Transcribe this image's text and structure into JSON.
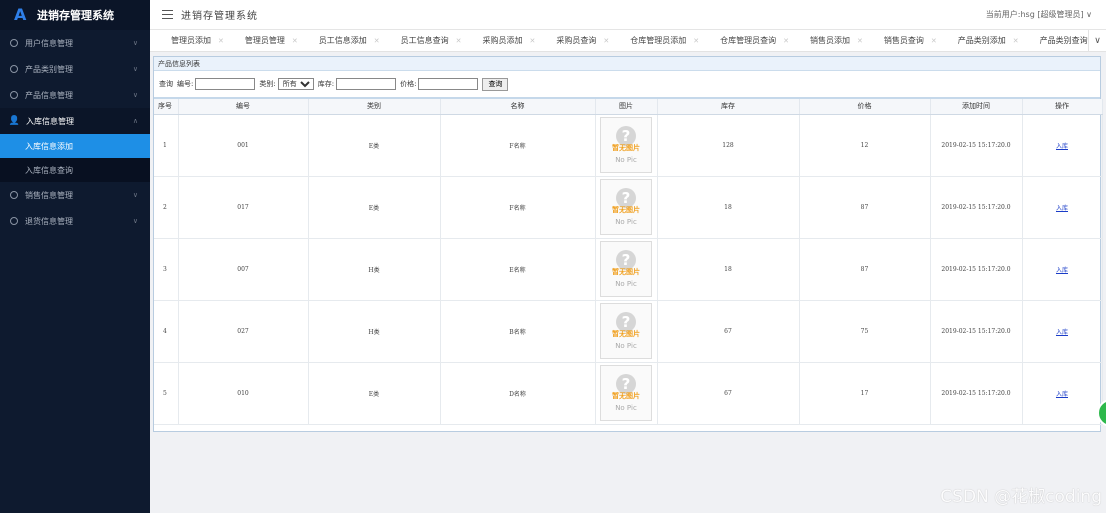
{
  "brand": {
    "logo": "A",
    "title": "进销存管理系统"
  },
  "sidebar": {
    "items": [
      {
        "label": "用户信息管理",
        "icon": "gear-icon"
      },
      {
        "label": "产品类别管理",
        "icon": "gear-icon"
      },
      {
        "label": "产品信息管理",
        "icon": "gear-icon"
      },
      {
        "label": "入库信息管理",
        "icon": "user-icon",
        "open": true,
        "children": [
          {
            "label": "入库信息添加",
            "active": true
          },
          {
            "label": "入库信息查询"
          }
        ]
      },
      {
        "label": "销售信息管理",
        "icon": "gear-icon"
      },
      {
        "label": "退货信息管理",
        "icon": "gear-icon"
      }
    ]
  },
  "header": {
    "title": "进销存管理系统",
    "user": "当前用户:hsg [超级管理员] ∨"
  },
  "tabs": [
    "管理员添加",
    "管理员管理",
    "员工信息添加",
    "员工信息查询",
    "采购员添加",
    "采购员查询",
    "仓库管理员添加",
    "仓库管理员查询",
    "销售员添加",
    "销售员查询",
    "产品类别添加",
    "产品类别查询"
  ],
  "panel": {
    "title": "产品信息列表",
    "search": {
      "query_label": "查询",
      "code_label": "编号:",
      "category_label": "类别:",
      "category_value": "所有",
      "stock_label": "库存:",
      "price_label": "价格:",
      "button": "查询"
    },
    "columns": [
      "序号",
      "编号",
      "类别",
      "名称",
      "图片",
      "库存",
      "价格",
      "添加时间",
      "操作"
    ],
    "nopic": {
      "cn": "暂无图片",
      "en": "No Pic"
    },
    "rows": [
      {
        "no": "1",
        "code": "001",
        "category": "E类",
        "name": "F名称",
        "stock": "128",
        "price": "12",
        "time": "2019-02-15 15:17:20.0",
        "action": "入库"
      },
      {
        "no": "2",
        "code": "017",
        "category": "E类",
        "name": "F名称",
        "stock": "18",
        "price": "87",
        "time": "2019-02-15 15:17:20.0",
        "action": "入库"
      },
      {
        "no": "3",
        "code": "007",
        "category": "H类",
        "name": "E名称",
        "stock": "18",
        "price": "87",
        "time": "2019-02-15 15:17:20.0",
        "action": "入库"
      },
      {
        "no": "4",
        "code": "027",
        "category": "H类",
        "name": "B名称",
        "stock": "67",
        "price": "75",
        "time": "2019-02-15 15:17:20.0",
        "action": "入库"
      },
      {
        "no": "5",
        "code": "010",
        "category": "E类",
        "name": "D名称",
        "stock": "67",
        "price": "17",
        "time": "2019-02-15 15:17:20.0",
        "action": "入库"
      }
    ]
  },
  "watermark": "CSDN @花椒coding",
  "colors": {
    "sidebar_bg": "#0e1a2f",
    "active_blue": "#1e8fe6",
    "link": "#1a3cc8"
  }
}
